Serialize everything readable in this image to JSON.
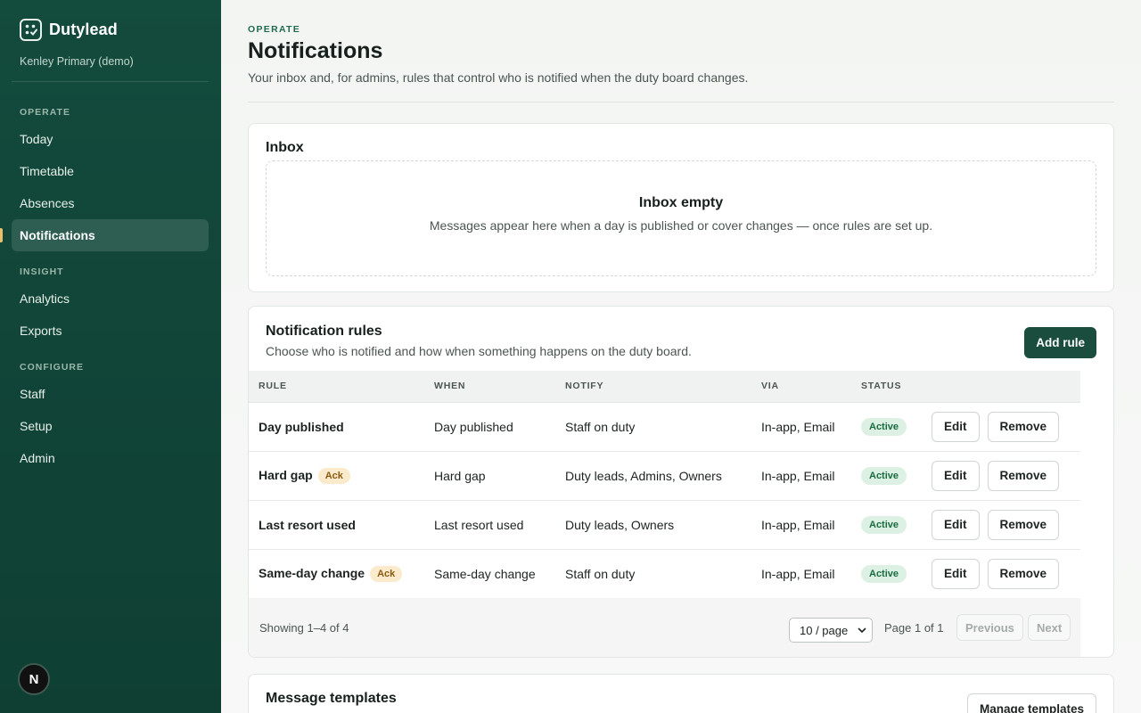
{
  "app": {
    "name": "Dutylead",
    "org": "Kenley Primary (demo)",
    "avatar_letter": "N"
  },
  "sidebar": {
    "sections": [
      {
        "label": "OPERATE",
        "items": [
          "Today",
          "Timetable",
          "Absences",
          "Notifications"
        ]
      },
      {
        "label": "INSIGHT",
        "items": [
          "Analytics",
          "Exports"
        ]
      },
      {
        "label": "CONFIGURE",
        "items": [
          "Staff",
          "Setup",
          "Admin"
        ]
      }
    ],
    "active": "Notifications"
  },
  "header": {
    "eyebrow": "OPERATE",
    "title": "Notifications",
    "subtitle": "Your inbox and, for admins, rules that control who is notified when the duty board changes."
  },
  "inbox": {
    "title": "Inbox",
    "empty_title": "Inbox empty",
    "empty_text": "Messages appear here when a day is published or cover changes — once rules are set up."
  },
  "rules": {
    "title": "Notification rules",
    "subtitle": "Choose who is notified and how when something happens on the duty board.",
    "add_label": "Add rule",
    "columns": [
      "RULE",
      "WHEN",
      "NOTIFY",
      "VIA",
      "STATUS"
    ],
    "rows": [
      {
        "rule": "Day published",
        "ack": "",
        "when": "Day published",
        "notify": "Staff on duty",
        "via": "In-app, Email",
        "status": "Active"
      },
      {
        "rule": "Hard gap",
        "ack": "Ack",
        "when": "Hard gap",
        "notify": "Duty leads, Admins, Owners",
        "via": "In-app, Email",
        "status": "Active"
      },
      {
        "rule": "Last resort used",
        "ack": "",
        "when": "Last resort used",
        "notify": "Duty leads, Owners",
        "via": "In-app, Email",
        "status": "Active"
      },
      {
        "rule": "Same-day change",
        "ack": "Ack",
        "when": "Same-day change",
        "notify": "Staff on duty",
        "via": "In-app, Email",
        "status": "Active"
      }
    ],
    "edit_label": "Edit",
    "remove_label": "Remove",
    "footer": {
      "showing": "Showing 1–4 of 4",
      "per_page": "10 / page",
      "page_of": "Page 1 of 1",
      "prev": "Previous",
      "next": "Next"
    }
  },
  "templates": {
    "title": "Message templates",
    "manage_label": "Manage templates"
  },
  "colors": {
    "sidebar": "#134b3d",
    "primary_button": "#1a4d3e",
    "accent_marker": "#e8c069",
    "active_badge": "#dcf1e4",
    "ack_badge": "#fbeacb"
  }
}
